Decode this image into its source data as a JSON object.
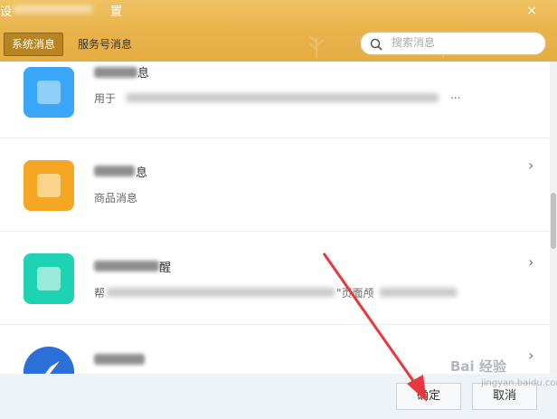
{
  "window": {
    "title_prefix": "设",
    "title_suffix": "置",
    "close_glyph": "×"
  },
  "tabs": [
    {
      "label": "系统消息",
      "active": true
    },
    {
      "label": "服务号消息",
      "active": false
    }
  ],
  "search": {
    "placeholder": "搜索消息"
  },
  "items": [
    {
      "name_visible": "息",
      "desc_prefix": "用于",
      "desc_suffix": "...",
      "icon_color": "#3aa6f6",
      "icon_inner": "#8fcff9"
    },
    {
      "name_visible": "息",
      "desc": "商品消息",
      "icon_color": "#f5a623",
      "icon_inner": "#fbd48c"
    },
    {
      "name_visible": "醒",
      "desc_prefix": "帮",
      "desc_mid": "\"页面颅",
      "icon_color": "#1ed3b4",
      "icon_inner": "#9aeadb"
    },
    {
      "name_visible": "",
      "icon_color": "#2b6fd8",
      "icon_inner": "#ffffff"
    }
  ],
  "footer": {
    "ok_label": "确定",
    "cancel_label": "取消"
  },
  "watermark": {
    "text": "Bai 经验",
    "sub": "jingyan.baidu.com"
  },
  "colors": {
    "titlebar": "#e9b24a",
    "tab_active": "#b78422",
    "arrow": "#e8383d"
  }
}
